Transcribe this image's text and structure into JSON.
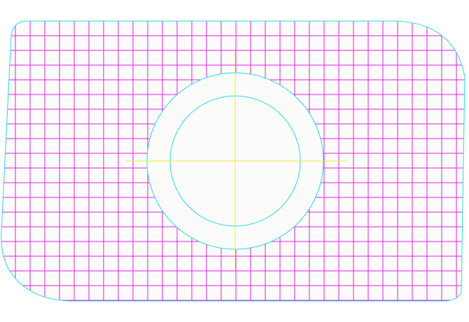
{
  "drawing": {
    "background_color": "#ffffff",
    "part_fill_color": "#fbfcf9",
    "outline_color": "#26d9ef",
    "hatch_color": "#e21ee6",
    "centerline_color": "#f3e83c",
    "features": {
      "outer_profile": "rounded-plate-outline",
      "fill_pattern": "rectangular-hatch-grid",
      "bore": "concentric-circles",
      "center_mark": "crosshair"
    }
  }
}
